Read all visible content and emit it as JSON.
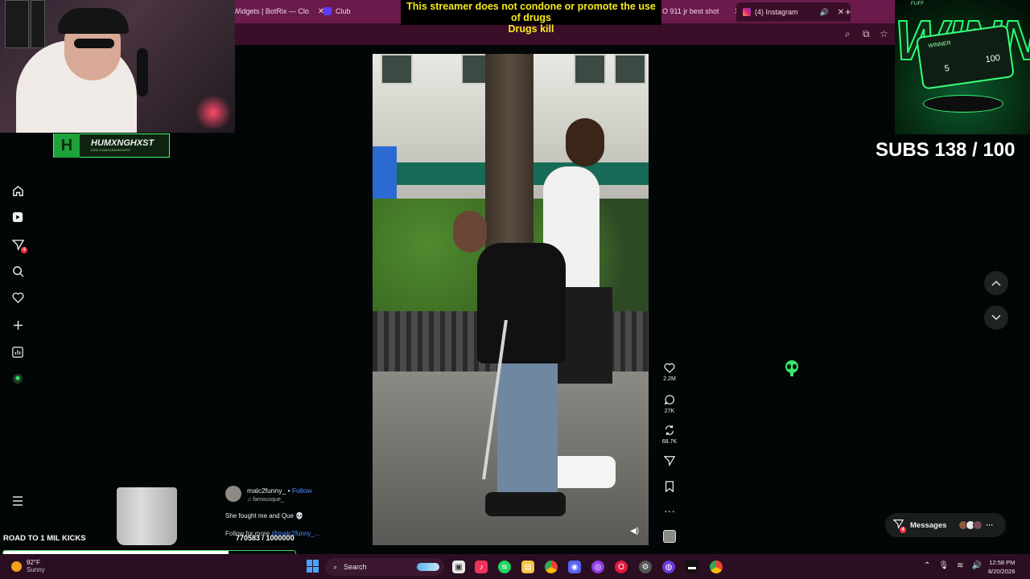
{
  "browser": {
    "tabs": [
      {
        "label": "Widgets | BotRix — Clo"
      },
      {
        "label": "Club"
      },
      {
        "label": "O 911 jr best shot"
      },
      {
        "label": "(4) Instagram"
      }
    ],
    "new_tab": "+"
  },
  "warning": {
    "line1": "This streamer does not condone or promote the use of drugs",
    "line2": "Drugs kill"
  },
  "streamer": {
    "name": "HUMXNGHXST",
    "sub": "KICK.COM/HUMXNGHXST"
  },
  "sidebar": {
    "items": [
      {
        "icon": "home-icon"
      },
      {
        "icon": "reels-icon"
      },
      {
        "icon": "messages-icon",
        "badge": "4"
      },
      {
        "icon": "search-icon"
      },
      {
        "icon": "heart-icon"
      },
      {
        "icon": "create-icon"
      },
      {
        "icon": "dashboard-icon"
      },
      {
        "icon": "profile-icon"
      }
    ],
    "more_icon": "menu-icon"
  },
  "post": {
    "username": "malc2funny_",
    "follow": "Follow",
    "audio": "famousque_",
    "caption": "She fought me and Que 💀",
    "caption2_prefix": "Follow for more ",
    "caption2_link": "@malc2funny_..."
  },
  "actions": {
    "likes": "2.2M",
    "comments": "27K",
    "reposts": "68.7K"
  },
  "overlay": {
    "subs": "SUBS 138 / 100",
    "fliff_brand": "FLIFF",
    "fliff_word": "WINNE",
    "card_label": "WINNER",
    "card_left": "5",
    "card_right": "100"
  },
  "goal": {
    "title": "ROAD TO 1 MIL KICKS",
    "count": "770583 / 1000000",
    "progress": 0.7706
  },
  "messages": {
    "label": "Messages",
    "badge": "4"
  },
  "taskbar": {
    "temp": "92°F",
    "condition": "Sunny",
    "search": "Search",
    "time": "12:58 PM",
    "date": "8/20/2026"
  },
  "colors": {
    "accent_green": "#39ff7d",
    "tab_bar": "#6b1b4b",
    "warning_text": "#f6ea1d",
    "link_blue": "#4a90ff"
  }
}
